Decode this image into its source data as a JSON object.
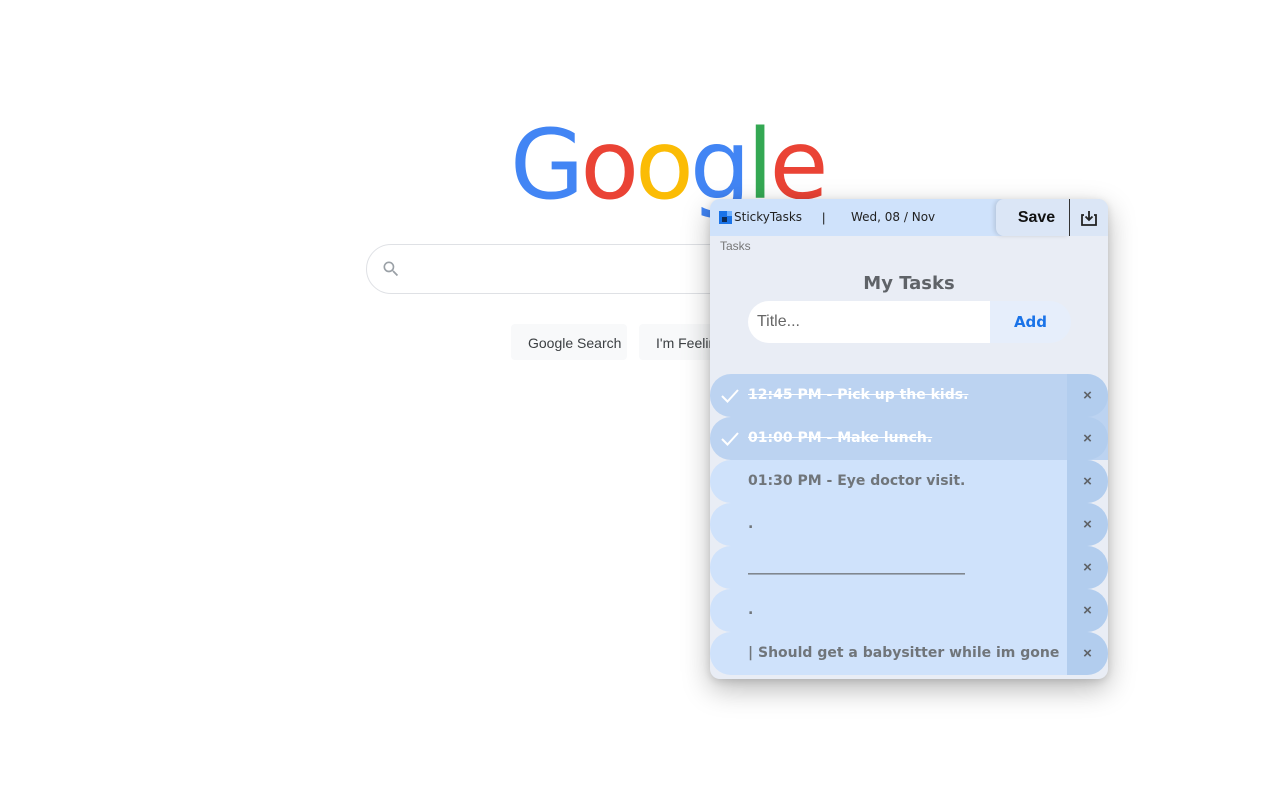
{
  "google": {
    "logo_letters": [
      {
        "char": "G",
        "color": "#4285F4"
      },
      {
        "char": "o",
        "color": "#EA4335"
      },
      {
        "char": "o",
        "color": "#FBBC05"
      },
      {
        "char": "g",
        "color": "#4285F4"
      },
      {
        "char": "l",
        "color": "#34A853"
      },
      {
        "char": "e",
        "color": "#EA4335"
      }
    ],
    "search": {
      "placeholder": "",
      "icon": "search-icon"
    },
    "buttons": {
      "search_label": "Google Search",
      "lucky_label": "I'm Feeling Lucky"
    }
  },
  "popup": {
    "brand": "StickyTasks",
    "separator": "|",
    "date": "Wed, 08 / Nov",
    "save_label": "Save",
    "export_icon": "download-icon",
    "tab_label": "Tasks",
    "title": "My Tasks",
    "input_placeholder": "Title...",
    "add_label": "Add",
    "close_glyph": "×",
    "colors": {
      "accent": "#1a73e8",
      "row": "#cfe2fb",
      "row_done": "#bcd3f1"
    },
    "tasks": [
      {
        "text": "12:45 PM - Pick up the kids.",
        "done": true
      },
      {
        "text": "01:00 PM - Make lunch.",
        "done": true
      },
      {
        "text": "01:30 PM - Eye doctor visit.",
        "done": false
      },
      {
        "text": ".",
        "done": false
      },
      {
        "text": "_______________________________",
        "done": false
      },
      {
        "text": ".",
        "done": false
      },
      {
        "text": "| Should get a babysitter while im gone |",
        "done": false
      }
    ]
  }
}
